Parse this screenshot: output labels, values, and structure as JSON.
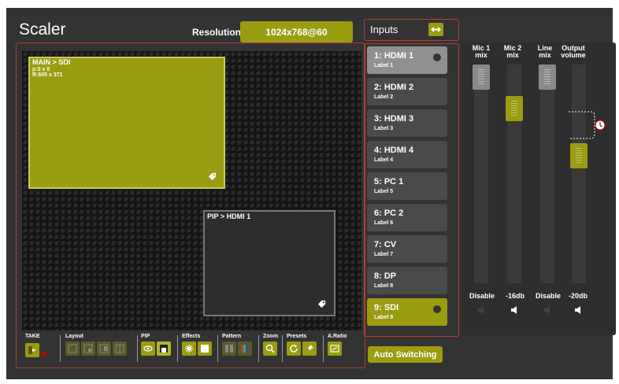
{
  "title": "Scaler",
  "resolution": {
    "label": "Resolution",
    "value": "1024x768@60"
  },
  "main_window": {
    "label": "MAIN > SDI",
    "position": "p:0 x 0",
    "size": "R:605 x 371"
  },
  "pip_window": {
    "label": "PIP > HDMI 1"
  },
  "toolbar": {
    "take": "TAKE",
    "layout": "Layout",
    "pip": "PIP",
    "effects": "Effects",
    "pattern": "Pattern",
    "zoom": "Zoom",
    "presets": "Presets",
    "aratio": "A.Ratio"
  },
  "inputs_header": "Inputs",
  "inputs": [
    {
      "name": "1: HDMI 1",
      "label": "Label 1"
    },
    {
      "name": "2: HDMI 2",
      "label": "Label 2"
    },
    {
      "name": "3: HDMI 3",
      "label": "Label 3"
    },
    {
      "name": "4: HDMI 4",
      "label": "Label 4"
    },
    {
      "name": "5: PC 1",
      "label": "Label 5"
    },
    {
      "name": "6: PC 2",
      "label": "Label 6"
    },
    {
      "name": "7: CV",
      "label": "Label 7"
    },
    {
      "name": "8: DP",
      "label": "Label 8"
    },
    {
      "name": "9: SDI",
      "label": "Label 9"
    }
  ],
  "auto_switching": "Auto Switching",
  "mixer": {
    "mic1": {
      "line1": "Mic 1",
      "line2": "mix",
      "value": "Disable"
    },
    "mic2": {
      "line1": "Mic 2",
      "line2": "mix",
      "value": "-16db"
    },
    "line": {
      "line1": "Line",
      "line2": "mix",
      "value": "Disable"
    },
    "output": {
      "line1": "Output",
      "line2": "volume",
      "value": "-20db"
    }
  },
  "colors": {
    "accent": "#9a9c12",
    "frame": "#b43c32",
    "background": "#333333"
  }
}
